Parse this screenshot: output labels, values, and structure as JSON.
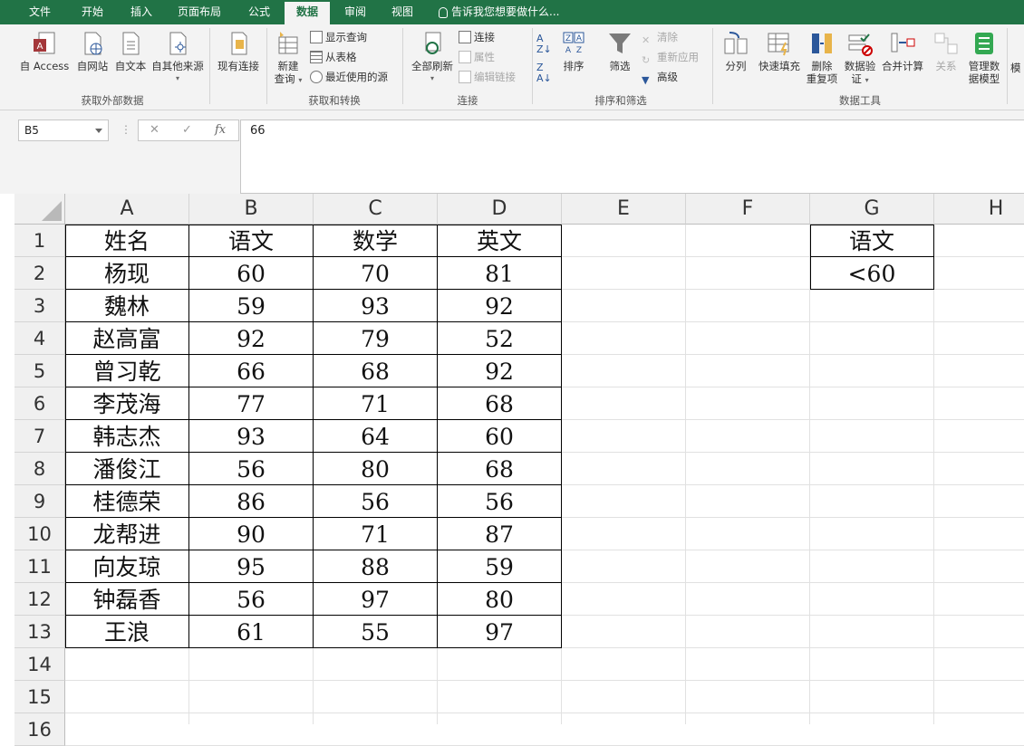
{
  "menu": {
    "tabs": [
      "文件",
      "开始",
      "插入",
      "页面布局",
      "公式",
      "数据",
      "审阅",
      "视图"
    ],
    "active_index": 5,
    "tell_me": "告诉我您想要做什么..."
  },
  "ribbon": {
    "get_external": {
      "buttons": [
        "自 Access",
        "自网站",
        "自文本",
        "自其他来源"
      ],
      "label": "获取外部数据"
    },
    "existing_connections": "现有连接",
    "get_transform": {
      "new_query_line1": "新建",
      "new_query_line2": "查询",
      "show_queries": "显示查询",
      "from_table": "从表格",
      "recent_sources": "最近使用的源",
      "label": "获取和转换"
    },
    "connections": {
      "refresh_all": "全部刷新",
      "connections": "连接",
      "properties": "属性",
      "edit_links": "编辑链接",
      "label": "连接"
    },
    "sort_filter": {
      "sort": "排序",
      "filter": "筛选",
      "clear": "清除",
      "reapply": "重新应用",
      "advanced": "高级",
      "label": "排序和筛选"
    },
    "data_tools": {
      "text_to_columns": "分列",
      "flash_fill": "快速填充",
      "remove_dup_line1": "删除",
      "remove_dup_line2": "重复项",
      "validation_line1": "数据验",
      "validation_line2": "证",
      "consolidate": "合并计算",
      "relationships": "关系",
      "manage_model_line1": "管理数",
      "manage_model_line2": "据模型",
      "label": "数据工具"
    },
    "cutoff": "模"
  },
  "formula_bar": {
    "name_box": "B5",
    "formula": "66"
  },
  "sheet": {
    "columns": [
      "A",
      "B",
      "C",
      "D",
      "E",
      "F",
      "G",
      "H"
    ],
    "row_numbers": [
      "1",
      "2",
      "3",
      "4",
      "5",
      "6",
      "7",
      "8",
      "9",
      "10",
      "11",
      "12",
      "13",
      "14",
      "15",
      "16"
    ],
    "table": {
      "header": [
        "姓名",
        "语文",
        "数学",
        "英文"
      ],
      "rows": [
        [
          "杨现",
          "60",
          "70",
          "81"
        ],
        [
          "魏林",
          "59",
          "93",
          "92"
        ],
        [
          "赵高富",
          "92",
          "79",
          "52"
        ],
        [
          "曾习乾",
          "66",
          "68",
          "92"
        ],
        [
          "李茂海",
          "77",
          "71",
          "68"
        ],
        [
          "韩志杰",
          "93",
          "64",
          "60"
        ],
        [
          "潘俊江",
          "56",
          "80",
          "68"
        ],
        [
          "桂德荣",
          "86",
          "56",
          "56"
        ],
        [
          "龙帮进",
          "90",
          "71",
          "87"
        ],
        [
          "向友琼",
          "95",
          "88",
          "59"
        ],
        [
          "钟磊香",
          "56",
          "97",
          "80"
        ],
        [
          "王浪",
          "61",
          "55",
          "97"
        ]
      ]
    },
    "criteria": {
      "header": "语文",
      "value": "<60"
    }
  }
}
